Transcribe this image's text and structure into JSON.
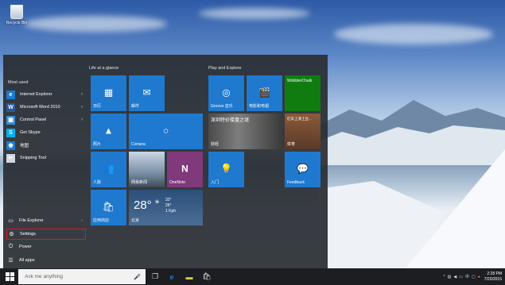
{
  "desktop": {
    "recycle_bin_label": "Recycle Bin"
  },
  "start_menu": {
    "most_used_label": "Most used",
    "apps": [
      {
        "label": "Internet Explorer",
        "icon": "internet-explorer-icon",
        "color": "#1e79cf",
        "glyph": "e",
        "has_arrow": true
      },
      {
        "label": "Microsoft Word 2010",
        "icon": "word-icon",
        "color": "#2b579a",
        "glyph": "W",
        "has_arrow": true
      },
      {
        "label": "Control Panel",
        "icon": "control-panel-icon",
        "color": "#3c8fd8",
        "glyph": "▦",
        "has_arrow": true
      },
      {
        "label": "Get Skype",
        "icon": "skype-icon",
        "color": "#00aff0",
        "glyph": "S",
        "has_arrow": false
      },
      {
        "label": "地图",
        "icon": "maps-icon",
        "color": "#1e79cf",
        "glyph": "◉",
        "has_arrow": false
      },
      {
        "label": "Snipping Tool",
        "icon": "snipping-tool-icon",
        "color": "#d0d8e4",
        "glyph": "✂",
        "has_arrow": false
      }
    ],
    "bottom": [
      {
        "label": "File Explorer",
        "icon": "folder-icon",
        "glyph": "▭",
        "has_arrow": true
      },
      {
        "label": "Settings",
        "icon": "gear-icon",
        "glyph": "⚙",
        "has_arrow": false
      },
      {
        "label": "Power",
        "icon": "power-icon",
        "glyph": "⏻",
        "has_arrow": false
      },
      {
        "label": "All apps",
        "icon": "all-apps-icon",
        "glyph": "☰",
        "has_arrow": false
      }
    ],
    "groups": {
      "life": "Life at a glance",
      "play": "Play and Explore"
    },
    "tiles": {
      "calendar": "日历",
      "mail": "邮件",
      "photos": "照片",
      "cortana": "Cortana",
      "people": "人脉",
      "news": "网易新闻",
      "onenote": "OneNote",
      "store": "应用商店",
      "weather_temp": "28°",
      "weather_hi": "32°",
      "weather_lo": "26°",
      "weather_wind": "1 Kph",
      "weather_city": "北京",
      "groove": "Groove 音乐",
      "movies": "电影和电视",
      "wobbler": "WobblerChalk",
      "money_headline": "深圳特价楼盘之谜",
      "money": "财经",
      "sports_headline": "红军上演土豆...",
      "sports": "体育",
      "getstarted": "入门",
      "feedback": "Feedback"
    }
  },
  "taskbar": {
    "search_placeholder": "Ask me anything",
    "time": "2:28 PM",
    "date": "7/20/2015"
  },
  "colors": {
    "tile_blue": "#1e79cf",
    "onenote_purple": "#80397b",
    "wobbler_green": "#107c10",
    "highlight_red": "#e81123"
  }
}
